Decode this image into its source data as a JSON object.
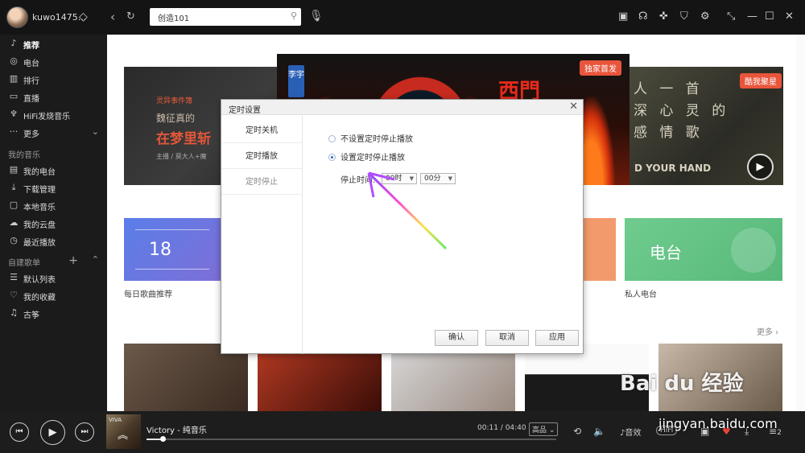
{
  "topbar": {
    "username": "kuwo1475...",
    "search_value": "创造101",
    "back_label": "‹",
    "refresh_label": "↻",
    "tools": [
      "skin-icon",
      "headphones-icon",
      "gamepad-icon",
      "tshirt-icon",
      "gear-icon",
      "mini-mode-icon",
      "minimize-icon",
      "maximize-icon",
      "close-icon"
    ]
  },
  "sidebar": {
    "items": [
      {
        "label": "推荐"
      },
      {
        "label": "电台"
      },
      {
        "label": "排行"
      },
      {
        "label": "直播"
      },
      {
        "label": "HiFi发烧音乐"
      },
      {
        "label": "更多"
      }
    ],
    "my_music_title": "我的音乐",
    "my_music": [
      {
        "label": "我的电台"
      },
      {
        "label": "下载管理"
      },
      {
        "label": "本地音乐"
      },
      {
        "label": "我的云盘"
      },
      {
        "label": "最近播放"
      }
    ],
    "playlist_title": "自建歌单",
    "playlists": [
      {
        "label": "默认列表"
      },
      {
        "label": "我的收藏"
      },
      {
        "label": "古筝"
      }
    ]
  },
  "banners": {
    "left": {
      "line1": "灵异事件簿",
      "line2": "魏征真的",
      "line3": "在梦里斩",
      "line4": "主播 / 莫大人+魔"
    },
    "center": {
      "side_tag": "李宇",
      "title": "西門",
      "badge": "独家首发"
    },
    "right": {
      "lines": "人 一 首\n深 心 灵 的\n感 情 歌",
      "english": "D YOUR HAND",
      "badge": "酷我聚星"
    }
  },
  "cards": {
    "daily_number": "18",
    "daily_label": "每日歌曲推荐",
    "radio_title": "电台",
    "radio_label": "私人电台"
  },
  "more_label": "更多",
  "dialog": {
    "title": "定时设置",
    "nav": [
      "定时关机",
      "定时播放",
      "定时停止"
    ],
    "option_off": "不设置定时停止播放",
    "option_on": "设置定时停止播放",
    "stop_time_label": "停止时间:",
    "hour_value": "00时",
    "minute_value": "00分",
    "confirm": "确认",
    "cancel": "取消",
    "apply": "应用"
  },
  "player": {
    "album_text": "VIVA",
    "song": "Victory - 纯音乐",
    "time": "00:11 / 04:40",
    "quality": "高品",
    "progress_fraction": 0.04,
    "playlist_count": "2"
  },
  "watermark": {
    "brand": "Bai du 经验",
    "url": "jingyan.baidu.com"
  }
}
